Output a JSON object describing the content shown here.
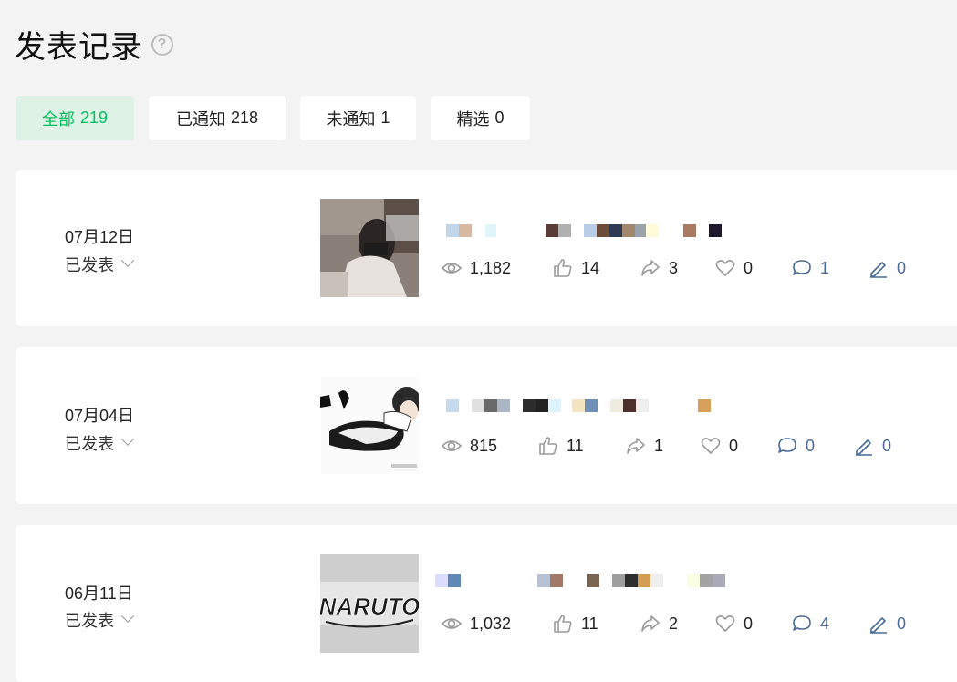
{
  "page": {
    "title": "发表记录"
  },
  "tabs": [
    {
      "label": "全部",
      "count": "219"
    },
    {
      "label": "已通知",
      "count": "218"
    },
    {
      "label": "未通知",
      "count": "1"
    },
    {
      "label": "精选",
      "count": "0"
    }
  ],
  "posts": [
    {
      "date": "07月12日",
      "status": "已发表",
      "stats": {
        "views": "1,182",
        "likes": "14",
        "shares": "3",
        "favorites": "0",
        "comments": "1",
        "notes": "0"
      }
    },
    {
      "date": "07月04日",
      "status": "已发表",
      "stats": {
        "views": "815",
        "likes": "11",
        "shares": "1",
        "favorites": "0",
        "comments": "0",
        "notes": "0"
      }
    },
    {
      "date": "06月11日",
      "status": "已发表",
      "stats": {
        "views": "1,032",
        "likes": "11",
        "shares": "2",
        "favorites": "0",
        "comments": "4",
        "notes": "0"
      }
    }
  ],
  "thumbnail_text": {
    "post3": "NARUTO"
  },
  "colors": {
    "accent": "#07c160",
    "active_tab_bg": "#def2e6",
    "blue_icon": "#4a6a9a",
    "icon_gray": "#9a9a9a"
  }
}
